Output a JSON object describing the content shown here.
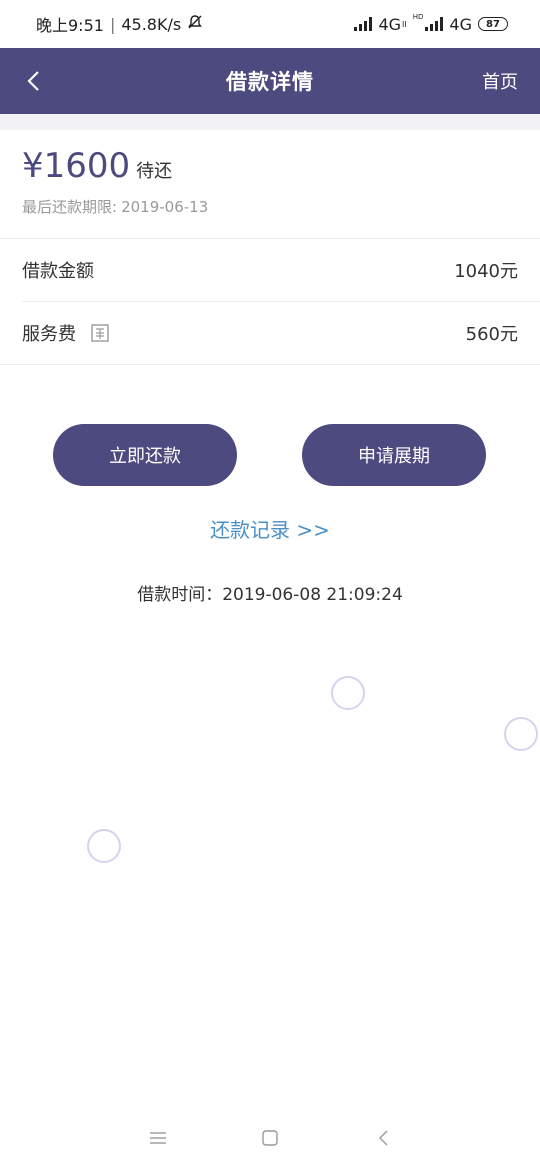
{
  "status_bar": {
    "time": "晚上9:51",
    "separator": "|",
    "speed": "45.8K/s",
    "net1": "4G",
    "net1_sub": "II",
    "hd": "HD",
    "net2": "4G",
    "battery": "87"
  },
  "nav": {
    "title": "借款详情",
    "home": "首页"
  },
  "summary": {
    "amount": "¥1600",
    "status": "待还",
    "deadline_label": "最后还款期限:",
    "deadline_date": "2019-06-13"
  },
  "details": [
    {
      "label": "借款金额",
      "value": "1040元"
    },
    {
      "label": "服务费",
      "value": "560元"
    }
  ],
  "actions": {
    "repay": "立即还款",
    "extend": "申请展期",
    "records": "还款记录 >>"
  },
  "loan_time": "借款时间：2019-06-08 21:09:24",
  "colors": {
    "primary": "#4c4a7f",
    "link": "#4a90c8",
    "muted": "#9a9a9a"
  }
}
